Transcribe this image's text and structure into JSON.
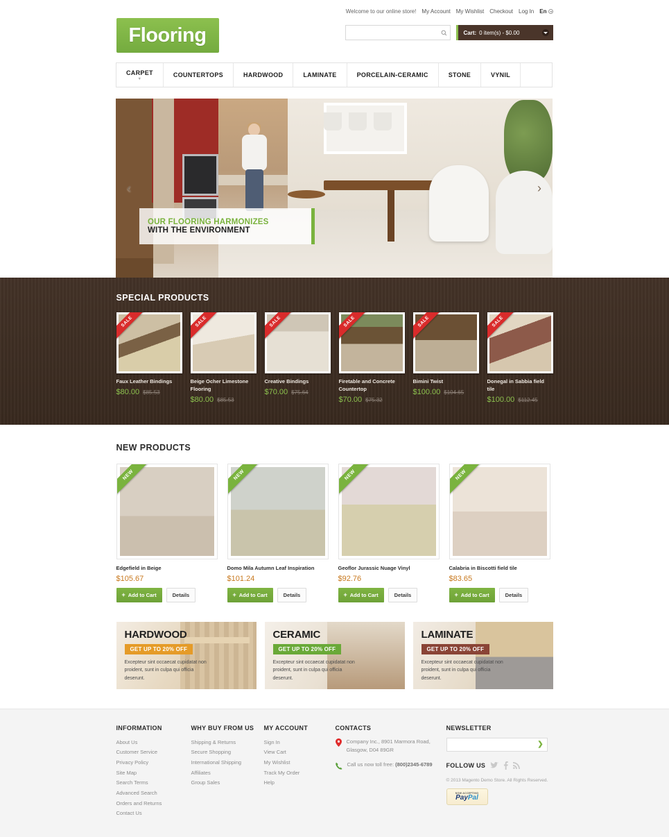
{
  "header": {
    "logo_text": "Flooring",
    "welcome": "Welcome to our online store!",
    "links": [
      "My Account",
      "My Wishlist",
      "Checkout",
      "Log In"
    ],
    "language": "En",
    "search_placeholder": "",
    "search_value": "",
    "search_icon": "search-icon",
    "cart_label": "Cart:",
    "cart_total": "0 item(s) - $0.00"
  },
  "nav": {
    "items": [
      {
        "label": "CARPET",
        "has_dropdown": true
      },
      {
        "label": "COUNTERTOPS",
        "has_dropdown": false
      },
      {
        "label": "HARDWOOD",
        "has_dropdown": false
      },
      {
        "label": "LAMINATE",
        "has_dropdown": false
      },
      {
        "label": "PORCELAIN-CERAMIC",
        "has_dropdown": false
      },
      {
        "label": "STONE",
        "has_dropdown": false
      },
      {
        "label": "VYNIL",
        "has_dropdown": false
      }
    ]
  },
  "hero": {
    "caption_line1": "OUR FLOORING HARMONIZES",
    "caption_line2": "WITH THE ENVIRONMENT",
    "prev_icon": "chevron-left-icon",
    "next_icon": "chevron-right-icon",
    "prev_glyph": "‹",
    "next_glyph": "›"
  },
  "special": {
    "title": "SPECIAL PRODUCTS",
    "ribbon_label": "SALE",
    "products": [
      {
        "name": "Faux Leather Bindings",
        "price": "$80.00",
        "old_price": "$85.53"
      },
      {
        "name": "Beige Ocher Limestone Flooring",
        "price": "$80.00",
        "old_price": "$85.53"
      },
      {
        "name": "Creative Bindings",
        "price": "$70.00",
        "old_price": "$75.64"
      },
      {
        "name": "Firetable and Concrete Countertop",
        "price": "$70.00",
        "old_price": "$75.32"
      },
      {
        "name": "Bimini Twist",
        "price": "$100.00",
        "old_price": "$104.65"
      },
      {
        "name": "Donegal in Sabbia field tile",
        "price": "$100.00",
        "old_price": "$112.45"
      }
    ]
  },
  "new_products": {
    "title": "NEW PRODUCTS",
    "ribbon_label": "NEW",
    "add_to_cart_label": "Add to Cart",
    "details_label": "Details",
    "products": [
      {
        "name": "Edgefield in Beige",
        "price": "$105.67"
      },
      {
        "name": "Domo Mila Autumn Leaf Inspiration",
        "price": "$101.24"
      },
      {
        "name": "Geoflor Jurassic Nuage Vinyl",
        "price": "$92.76"
      },
      {
        "name": "Calabria in Biscotti field tile",
        "price": "$83.65"
      }
    ]
  },
  "promos": [
    {
      "title": "HARDWOOD",
      "badge": "GET UP TO 20% OFF",
      "badge_color": "#e59b28",
      "desc": "Excepteur sint occaecat cupidatat non proident, sunt in culpa qui officia deserunt."
    },
    {
      "title": "CERAMIC",
      "badge": "GET UP TO 20% OFF",
      "badge_color": "#6aa938",
      "desc": "Excepteur sint occaecat cupidatat non proident, sunt in culpa qui officia deserunt."
    },
    {
      "title": "LAMINATE",
      "badge": "GET UP TO 20% OFF",
      "badge_color": "#8a4436",
      "desc": "Excepteur sint occaecat cupidatat non proident, sunt in culpa qui officia deserunt."
    }
  ],
  "footer": {
    "information": {
      "title": "INFORMATION",
      "items": [
        "About Us",
        "Customer Service",
        "Privacy Policy",
        "Site Map",
        "Search Terms",
        "Advanced Search",
        "Orders and Returns",
        "Contact Us"
      ]
    },
    "why_buy": {
      "title": "WHY BUY FROM US",
      "items": [
        "Shipping & Returns",
        "Secure Shopping",
        "International Shipping",
        "Affiliates",
        "Group Sales"
      ]
    },
    "my_account": {
      "title": "MY ACCOUNT",
      "items": [
        "Sign In",
        "View Cart",
        "My Wishlist",
        "Track My Order",
        "Help"
      ]
    },
    "contacts": {
      "title": "CONTACTS",
      "address": "Company Inc., 8901 Marmora Road, Glasgow, D04 89GR",
      "phone_label": "Call us now toll free:",
      "phone": "(800)2345-6789",
      "pin_icon": "map-pin-icon",
      "phone_icon": "phone-icon"
    },
    "newsletter": {
      "title": "NEWSLETTER",
      "placeholder": "",
      "value": "",
      "submit_icon": "chevron-right-icon",
      "submit_glyph": "❯"
    },
    "follow": {
      "label": "FOLLOW US",
      "icons": [
        "twitter-icon",
        "facebook-icon",
        "rss-icon"
      ],
      "glyphs": [
        "🐦",
        "f",
        "◔"
      ]
    },
    "copyright": "© 2013 Magento Demo Store. All Rights Reserved.",
    "paypal": {
      "top": "NOW ACCEPTING",
      "brand_1": "Pay",
      "brand_2": "Pal"
    }
  },
  "colors": {
    "brand_green": "#7ab33e",
    "dark_wood": "#3e2e24",
    "cart_brown": "#4a352a",
    "sale_red": "#d92b2b",
    "new_price_orange": "#c8791f"
  }
}
